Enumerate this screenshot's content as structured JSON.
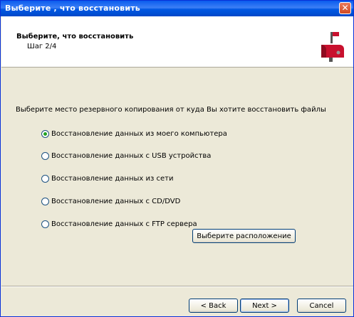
{
  "window": {
    "title": "Выберите , что восстановить",
    "close_label": "✕"
  },
  "header": {
    "title": "Выберите, что восстановить",
    "step": "Шаг 2/4",
    "icon": "mailbox-icon"
  },
  "prompt": "Выберите место резервного копирования от куда Вы хотите восстановить файлы",
  "options": [
    {
      "label": "Восстановление данных из моего компьютера",
      "selected": true
    },
    {
      "label": "Восстановление данных с USB устройства",
      "selected": false
    },
    {
      "label": "Восстановление данных из сети",
      "selected": false
    },
    {
      "label": "Восстановление данных с CD/DVD",
      "selected": false
    },
    {
      "label": "Восстановление данных с FTP сервера",
      "selected": false
    }
  ],
  "choose_location_label": "Выберите расположение",
  "buttons": {
    "back": "< Back",
    "next": "Next >",
    "cancel": "Cancel"
  },
  "colors": {
    "titlebar": "#0a5cee",
    "dialog_bg": "#ece9d8",
    "radio_selected": "#21a121",
    "close": "#d24a22"
  }
}
